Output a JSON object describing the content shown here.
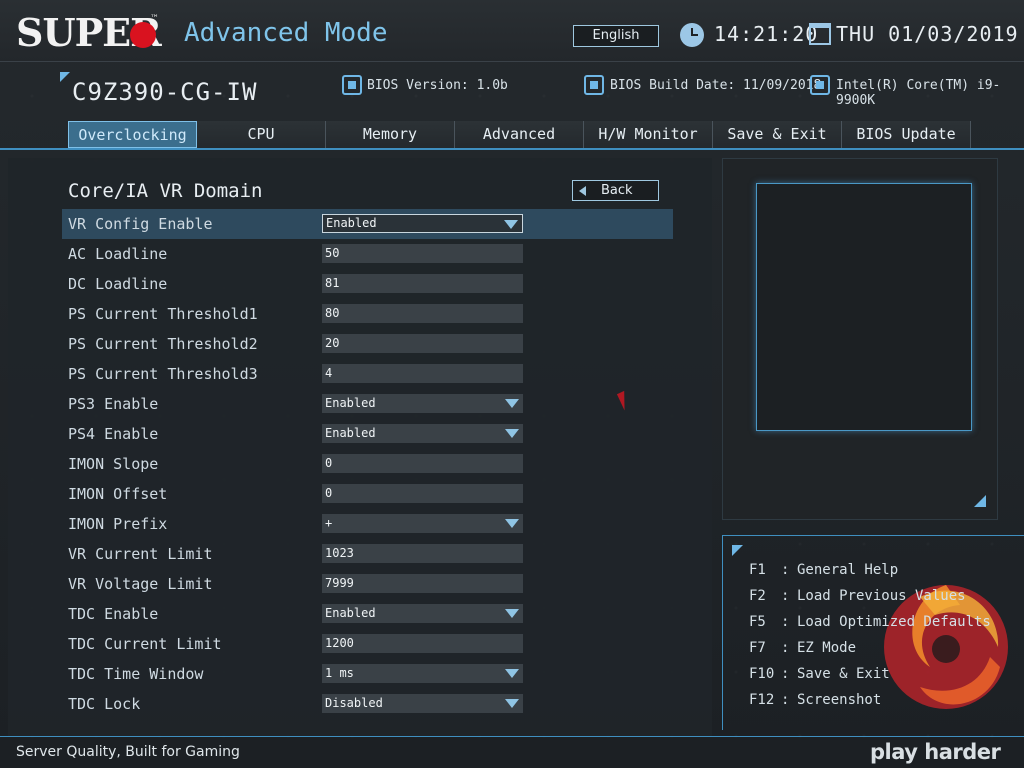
{
  "header": {
    "brand": "SUPER",
    "brand_tm": "™",
    "mode_title": "Advanced Mode",
    "language": "English",
    "time": "14:21:20",
    "date": "THU 01/03/2019"
  },
  "info": {
    "model": "C9Z390-CG-IW",
    "bios_version": "BIOS Version: 1.0b",
    "bios_build_date": "BIOS Build Date: 11/09/2018",
    "cpu": "Intel(R) Core(TM) i9-9900K"
  },
  "tabs": [
    "Overclocking",
    "CPU",
    "Memory",
    "Advanced",
    "H/W Monitor",
    "Save & Exit",
    "BIOS Update"
  ],
  "active_tab": "Overclocking",
  "section": {
    "title": "Core/IA VR Domain",
    "back_label": "Back"
  },
  "settings": [
    {
      "label": "VR Config Enable",
      "value": "Enabled",
      "dropdown": true,
      "selected": true
    },
    {
      "label": "AC Loadline",
      "value": "50",
      "dropdown": false
    },
    {
      "label": "DC Loadline",
      "value": "81",
      "dropdown": false
    },
    {
      "label": "PS Current Threshold1",
      "value": "80",
      "dropdown": false
    },
    {
      "label": "PS Current Threshold2",
      "value": "20",
      "dropdown": false
    },
    {
      "label": "PS Current Threshold3",
      "value": "4",
      "dropdown": false
    },
    {
      "label": "PS3 Enable",
      "value": "Enabled",
      "dropdown": true
    },
    {
      "label": "PS4 Enable",
      "value": "Enabled",
      "dropdown": true
    },
    {
      "label": "IMON Slope",
      "value": "0",
      "dropdown": false
    },
    {
      "label": "IMON Offset",
      "value": "0",
      "dropdown": false
    },
    {
      "label": "IMON Prefix",
      "value": "+",
      "dropdown": true
    },
    {
      "label": "VR Current Limit",
      "value": "1023",
      "dropdown": false
    },
    {
      "label": "VR Voltage Limit",
      "value": "7999",
      "dropdown": false
    },
    {
      "label": "TDC Enable",
      "value": "Enabled",
      "dropdown": true
    },
    {
      "label": "TDC Current Limit",
      "value": "1200",
      "dropdown": false
    },
    {
      "label": "TDC Time Window",
      "value": "1 ms",
      "dropdown": true
    },
    {
      "label": "TDC Lock",
      "value": "Disabled",
      "dropdown": true
    }
  ],
  "help": [
    {
      "key": "F1",
      "text": "General Help"
    },
    {
      "key": "F2",
      "text": "Load Previous Values"
    },
    {
      "key": "F5",
      "text": "Load Optimized Defaults"
    },
    {
      "key": "F7",
      "text": "EZ Mode"
    },
    {
      "key": "F10",
      "text": "Save & Exit"
    },
    {
      "key": "F12",
      "text": "Screenshot"
    }
  ],
  "footer": {
    "slogan": "Server Quality, Built for Gaming",
    "tagline": "play harder"
  },
  "colors": {
    "accent": "#3f8fc0",
    "brand_red": "#d9121f",
    "mode_title": "#7fc4ea"
  },
  "icons": [
    "clock-icon",
    "calendar-icon",
    "chip-icon",
    "chip-build-icon",
    "cpu-icon",
    "back-arrow-icon",
    "dropdown-arrow-icon"
  ]
}
